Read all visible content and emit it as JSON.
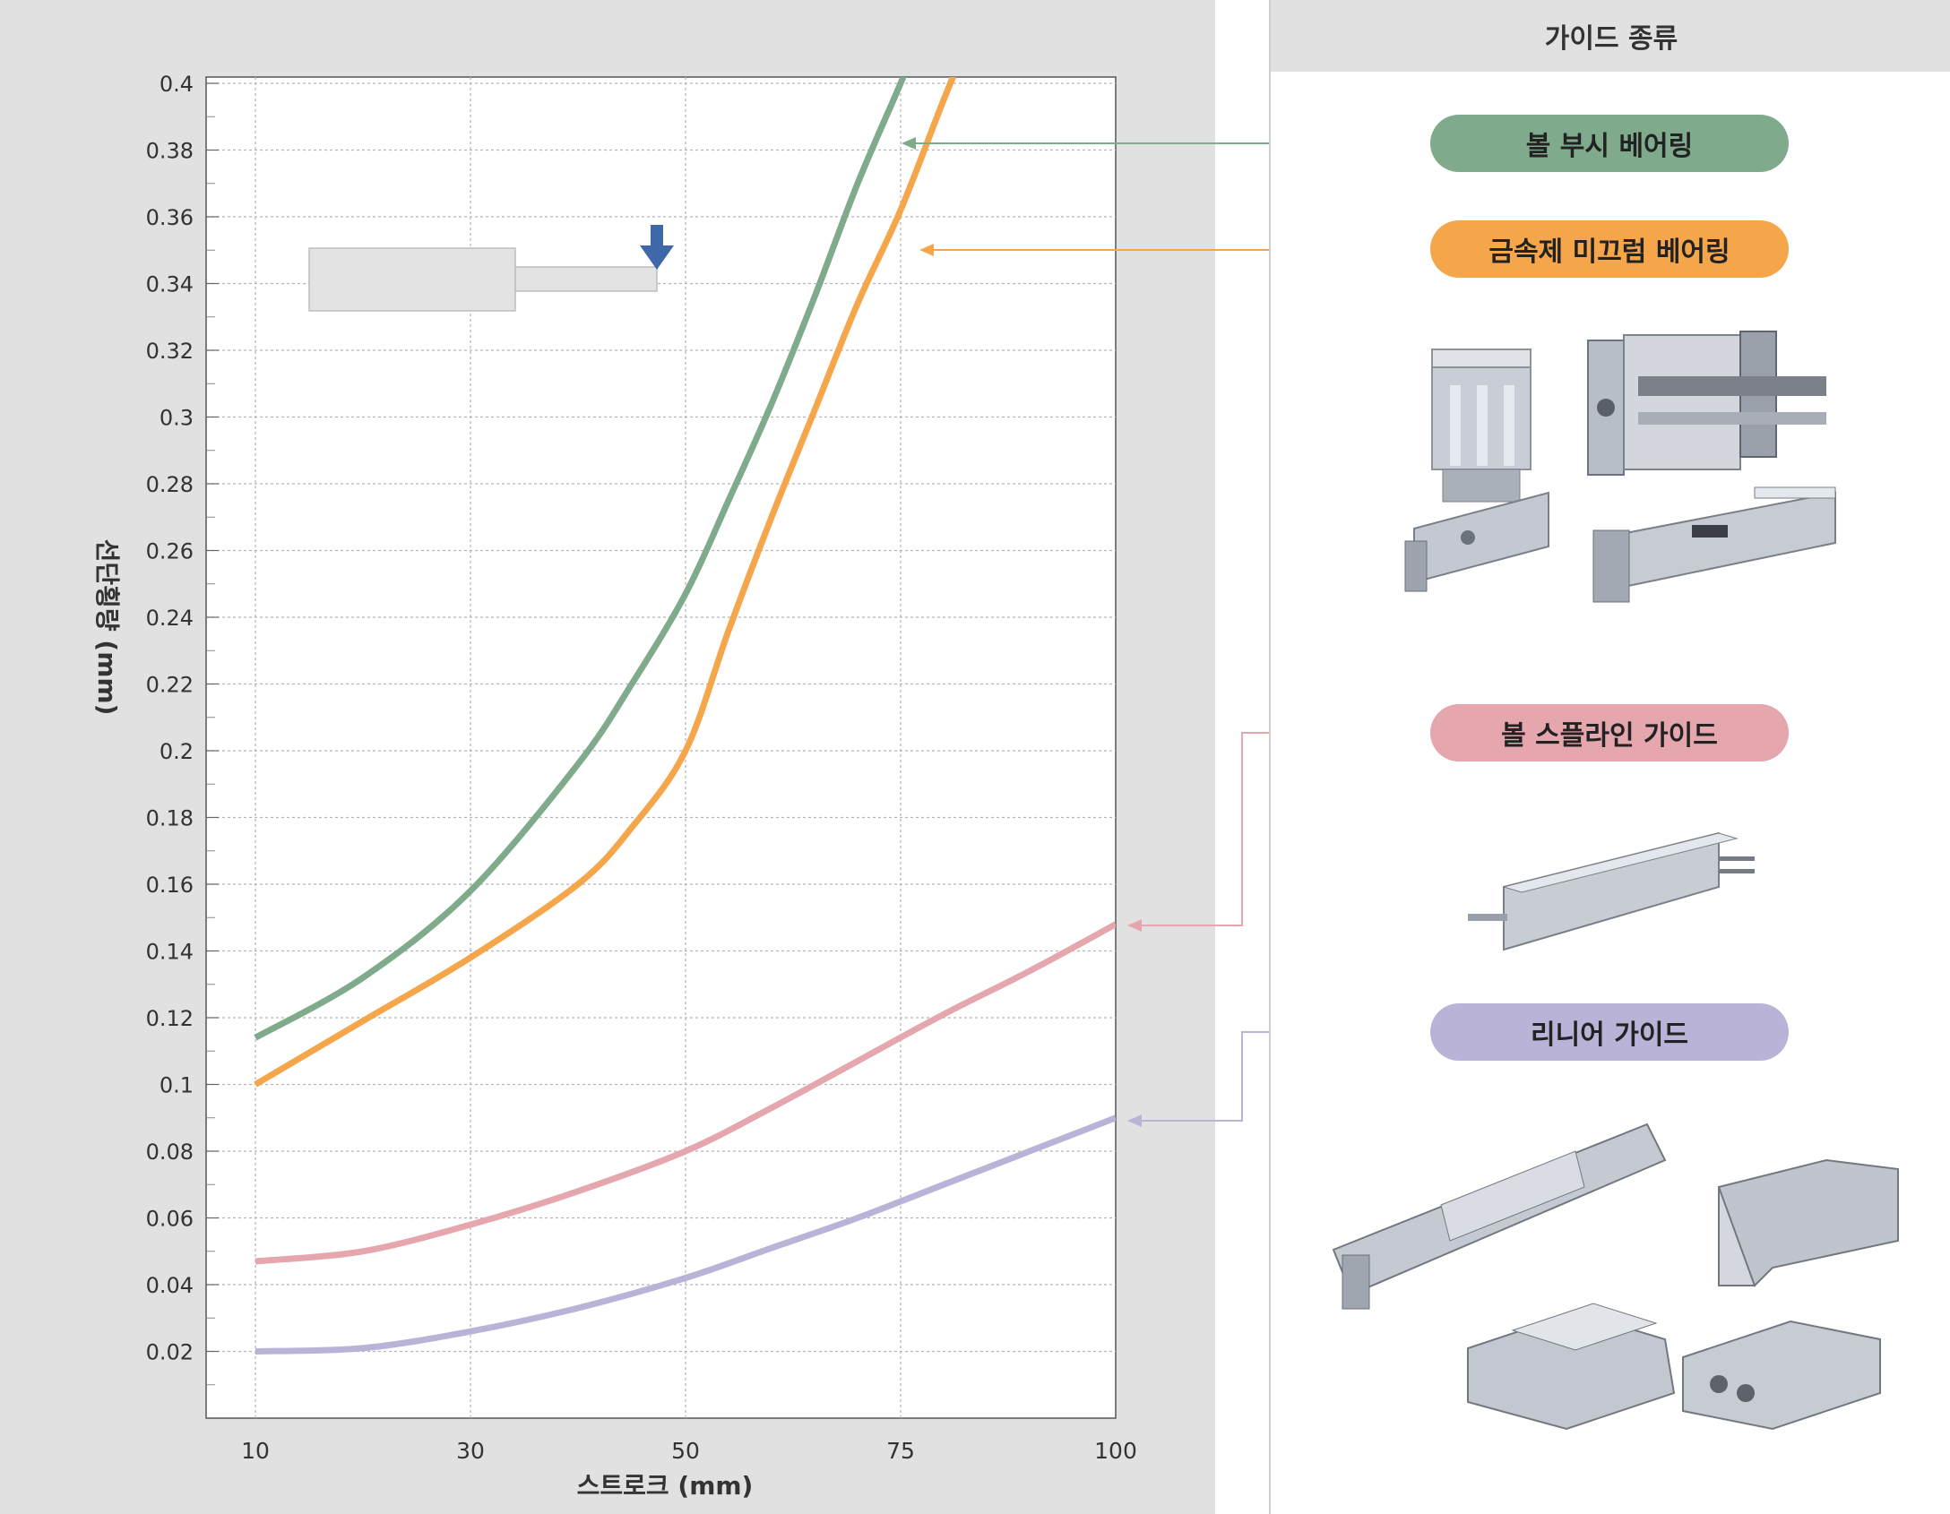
{
  "chart_data": {
    "type": "line",
    "xlabel": "스트로크 (mm)",
    "ylabel": "선단횡량 (mm)",
    "x_ticks": [
      "10",
      "30",
      "50",
      "75",
      "100"
    ],
    "y_ticks": [
      "0.02",
      "0.04",
      "0.06",
      "0.08",
      "0.1",
      "0.12",
      "0.14",
      "0.16",
      "0.18",
      "0.2",
      "0.22",
      "0.24",
      "0.26",
      "0.28",
      "0.3",
      "0.32",
      "0.34",
      "0.36",
      "0.38",
      "0.4"
    ],
    "ylim": [
      0,
      0.4
    ],
    "grid": true,
    "series": [
      {
        "name": "볼 부시 베어링",
        "color": "#7faa8b",
        "x": [
          10,
          20,
          30,
          40,
          45,
          50,
          55,
          60,
          65,
          70,
          75,
          77
        ],
        "y": [
          0.114,
          0.132,
          0.158,
          0.196,
          0.22,
          0.247,
          0.275,
          0.304,
          0.336,
          0.37,
          0.4,
          0.413
        ]
      },
      {
        "name": "금속제 미끄럼 베어링",
        "color": "#f5a64a",
        "x": [
          10,
          20,
          30,
          40,
          45,
          50,
          55,
          60,
          65,
          70,
          75,
          80,
          84
        ],
        "y": [
          0.1,
          0.119,
          0.138,
          0.16,
          0.177,
          0.2,
          0.236,
          0.27,
          0.302,
          0.334,
          0.362,
          0.395,
          0.42
        ]
      },
      {
        "name": "볼 스플라인 가이드",
        "color": "#e5a6ae",
        "x": [
          10,
          20,
          30,
          40,
          50,
          60,
          70,
          80,
          90,
          100
        ],
        "y": [
          0.047,
          0.05,
          0.058,
          0.068,
          0.08,
          0.093,
          0.107,
          0.121,
          0.134,
          0.148
        ]
      },
      {
        "name": "리니어 가이드",
        "color": "#b9b3d8",
        "x": [
          10,
          20,
          30,
          40,
          50,
          60,
          70,
          80,
          90,
          100
        ],
        "y": [
          0.02,
          0.021,
          0.026,
          0.033,
          0.042,
          0.051,
          0.06,
          0.07,
          0.08,
          0.09
        ]
      }
    ]
  },
  "guide_panel": {
    "title": "가이드 종류",
    "items": [
      {
        "label": "볼 부시 베어링",
        "color": "#7faa8b"
      },
      {
        "label": "금속제 미끄럼 베어링",
        "color": "#f5a64a"
      },
      {
        "label": "볼 스플라인 가이드",
        "color": "#e5a6ae"
      },
      {
        "label": "리니어 가이드",
        "color": "#b9b3d8"
      }
    ]
  }
}
